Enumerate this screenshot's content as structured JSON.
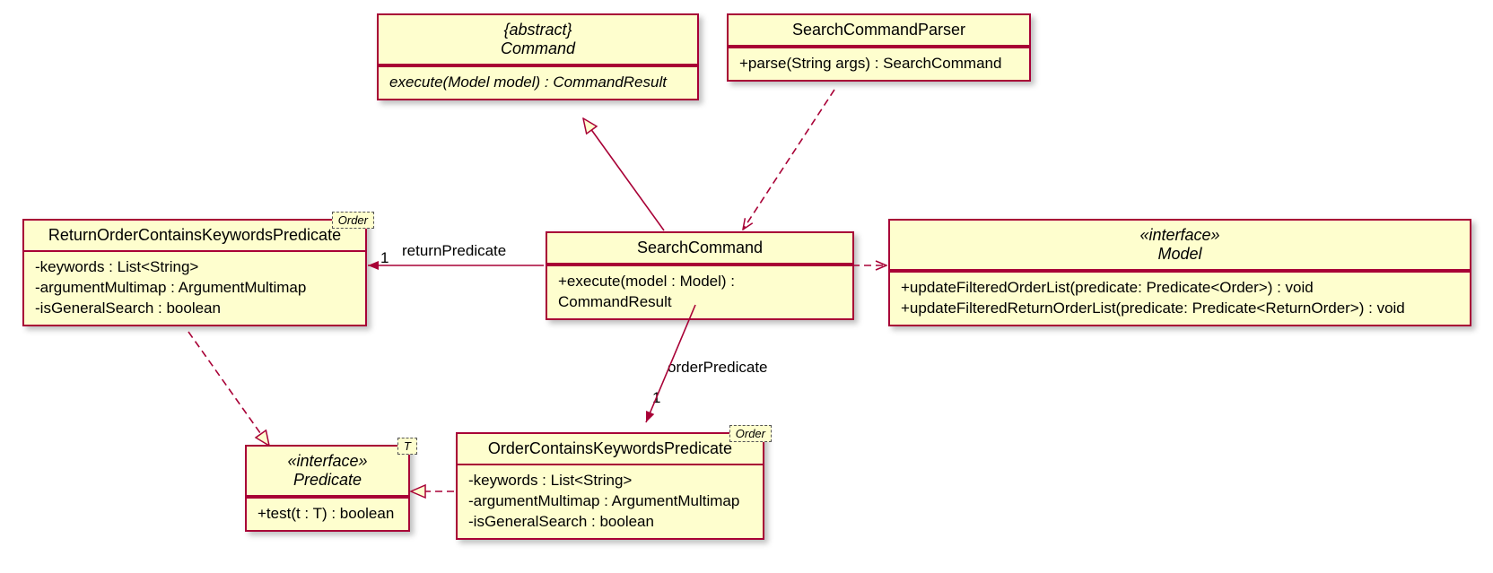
{
  "classes": {
    "command": {
      "stereo": "{abstract}",
      "name": "Command",
      "op": "execute(Model model) : CommandResult"
    },
    "parser": {
      "name": "SearchCommandParser",
      "op": "+parse(String args) : SearchCommand"
    },
    "searchCmd": {
      "name": "SearchCommand",
      "op": "+execute(model : Model) : CommandResult"
    },
    "model": {
      "stereo": "«interface»",
      "name": "Model",
      "op1": "+updateFilteredOrderList(predicate: Predicate<Order>) : void",
      "op2": "+updateFilteredReturnOrderList(predicate: Predicate<ReturnOrder>) : void"
    },
    "retPred": {
      "tparam": "Order",
      "name": "ReturnOrderContainsKeywordsPredicate",
      "a1": "-keywords : List<String>",
      "a2": "-argumentMultimap : ArgumentMultimap",
      "a3": "-isGeneralSearch : boolean"
    },
    "ordPred": {
      "tparam": "Order",
      "name": "OrderContainsKeywordsPredicate",
      "a1": "-keywords : List<String>",
      "a2": "-argumentMultimap : ArgumentMultimap",
      "a3": "-isGeneralSearch : boolean"
    },
    "predicate": {
      "tparam": "T",
      "stereo": "«interface»",
      "name": "Predicate",
      "op": "+test(t : T) : boolean"
    }
  },
  "labels": {
    "returnPredicate": "returnPredicate",
    "returnPredicateMult": "1",
    "orderPredicate": "orderPredicate",
    "orderPredicateMult": "1"
  },
  "chart_data": {
    "type": "uml-class-diagram",
    "classes": [
      {
        "id": "Command",
        "stereotype": "{abstract}",
        "operations": [
          "execute(Model model) : CommandResult"
        ]
      },
      {
        "id": "SearchCommandParser",
        "operations": [
          "+parse(String args) : SearchCommand"
        ]
      },
      {
        "id": "SearchCommand",
        "operations": [
          "+execute(model : Model) : CommandResult"
        ]
      },
      {
        "id": "Model",
        "stereotype": "«interface»",
        "operations": [
          "+updateFilteredOrderList(predicate: Predicate<Order>) : void",
          "+updateFilteredReturnOrderList(predicate: Predicate<ReturnOrder>) : void"
        ]
      },
      {
        "id": "ReturnOrderContainsKeywordsPredicate",
        "template": "Order",
        "attributes": [
          "-keywords : List<String>",
          "-argumentMultimap : ArgumentMultimap",
          "-isGeneralSearch : boolean"
        ]
      },
      {
        "id": "OrderContainsKeywordsPredicate",
        "template": "Order",
        "attributes": [
          "-keywords : List<String>",
          "-argumentMultimap : ArgumentMultimap",
          "-isGeneralSearch : boolean"
        ]
      },
      {
        "id": "Predicate",
        "stereotype": "«interface»",
        "template": "T",
        "operations": [
          "+test(t : T) : boolean"
        ]
      }
    ],
    "relations": [
      {
        "from": "SearchCommand",
        "to": "Command",
        "type": "generalization"
      },
      {
        "from": "SearchCommandParser",
        "to": "SearchCommand",
        "type": "dependency"
      },
      {
        "from": "SearchCommand",
        "to": "Model",
        "type": "dependency"
      },
      {
        "from": "SearchCommand",
        "to": "ReturnOrderContainsKeywordsPredicate",
        "type": "association",
        "role": "returnPredicate",
        "multiplicity": "1"
      },
      {
        "from": "SearchCommand",
        "to": "OrderContainsKeywordsPredicate",
        "type": "association",
        "role": "orderPredicate",
        "multiplicity": "1"
      },
      {
        "from": "ReturnOrderContainsKeywordsPredicate",
        "to": "Predicate",
        "type": "realization"
      },
      {
        "from": "OrderContainsKeywordsPredicate",
        "to": "Predicate",
        "type": "realization"
      }
    ]
  }
}
